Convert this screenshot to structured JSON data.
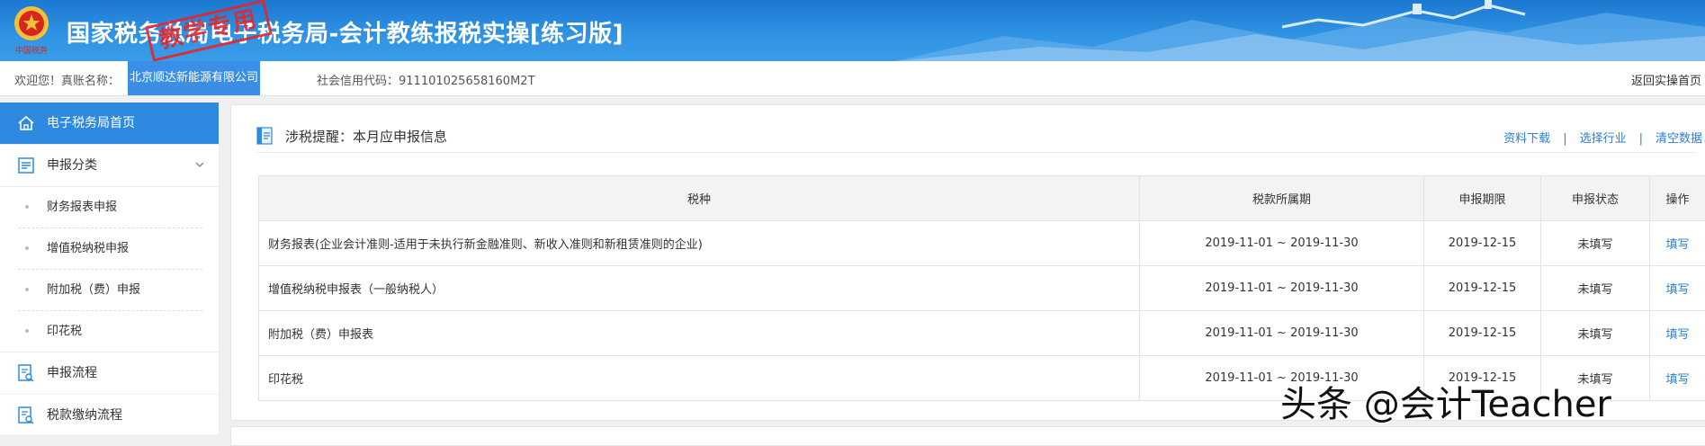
{
  "banner": {
    "title": "国家税务总局电子税务局-会计教练报税实操[练习版]",
    "stamp": "教学专用",
    "emblem_caption": "中国税务"
  },
  "infobar": {
    "welcome": "欢迎您！真账名称：",
    "company": "北京顺达新能源有限公司",
    "credit_label": "社会信用代码：",
    "credit_code": "911101025658160M2T",
    "back_link": "返回实操首页"
  },
  "sidebar": {
    "home": "电子税务局首页",
    "category": "申报分类",
    "sub_items": [
      "财务报表申报",
      "增值税纳税申报",
      "附加税（费）申报",
      "印花税"
    ],
    "flow": "申报流程",
    "payment": "税款缴纳流程"
  },
  "panel": {
    "title": "涉税提醒：本月应申报信息",
    "links": [
      "资料下载",
      "选择行业",
      "清空数据"
    ],
    "link_sep": "|"
  },
  "table": {
    "headers": [
      "税种",
      "税款所属期",
      "申报期限",
      "申报状态",
      "操作"
    ],
    "rows": [
      [
        "财务报表(企业会计准则-适用于未执行新金融准则、新收入准则和新租赁准则的企业)",
        "2019-11-01 ~ 2019-11-30",
        "2019-12-15",
        "未填写",
        "填写"
      ],
      [
        "增值税纳税申报表（一般纳税人）",
        "2019-11-01 ~ 2019-11-30",
        "2019-12-15",
        "未填写",
        "填写"
      ],
      [
        "附加税（费）申报表",
        "2019-11-01 ~ 2019-11-30",
        "2019-12-15",
        "未填写",
        "填写"
      ],
      [
        "印花税",
        "2019-11-01 ~ 2019-11-30",
        "2019-12-15",
        "未填写",
        "填写"
      ]
    ]
  },
  "watermark": "头条 @会计Teacher",
  "colors": {
    "accent": "#2d8ae0",
    "banner": "#2f92e4",
    "stamp": "#e4262b",
    "link": "#2a7fd4"
  }
}
